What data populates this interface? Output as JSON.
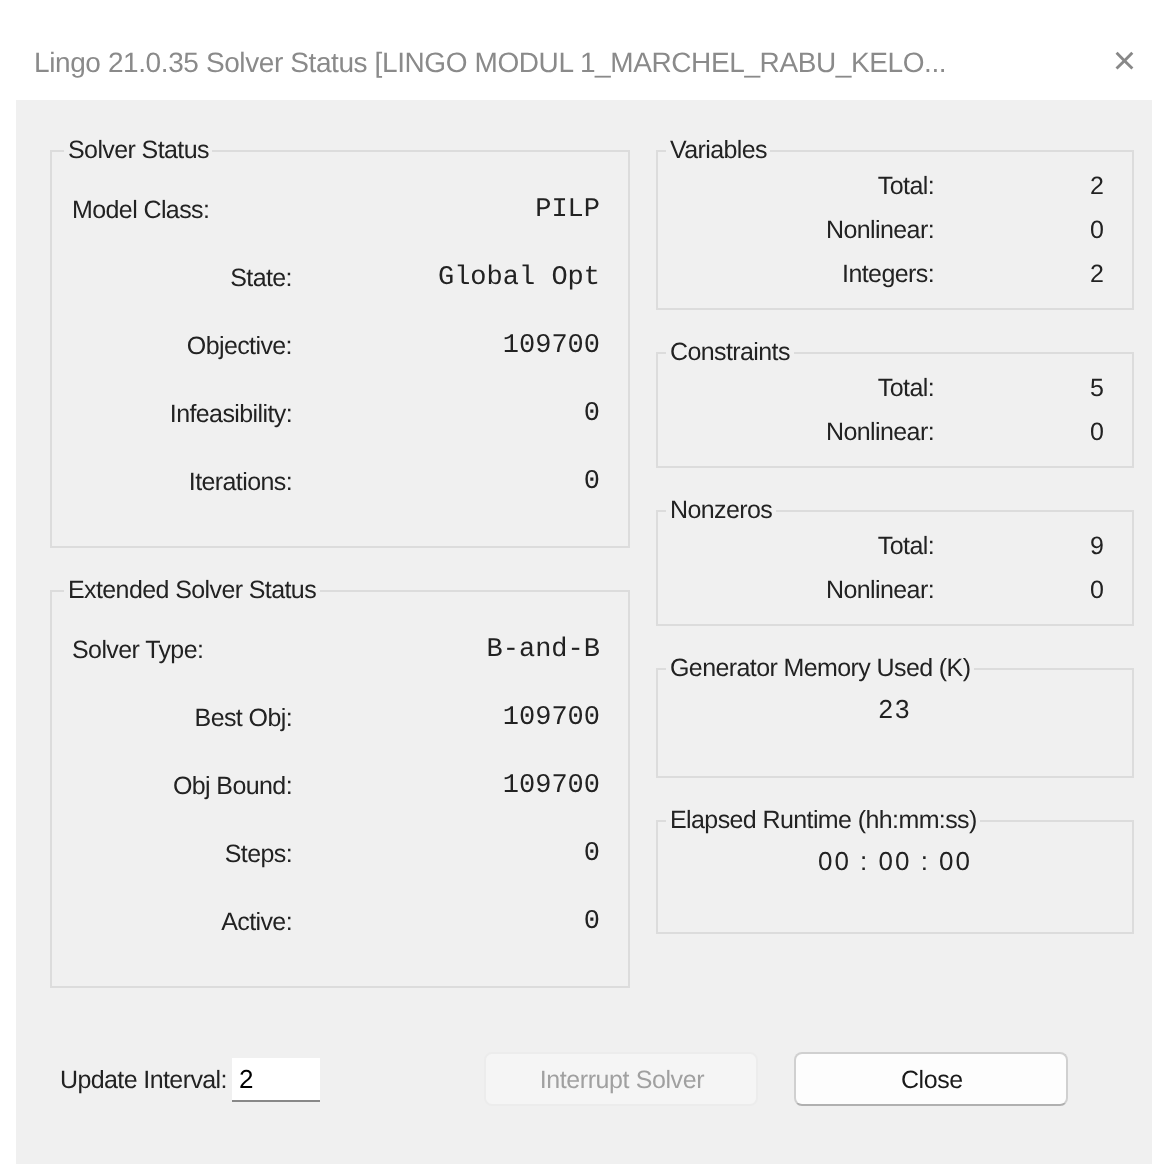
{
  "window": {
    "title": "Lingo 21.0.35 Solver Status [LINGO MODUL 1_MARCHEL_RABU_KELO...",
    "close": "×"
  },
  "solver_status": {
    "title": "Solver Status",
    "rows": [
      {
        "label": "Model Class:",
        "value": "PILP",
        "kind": "leading"
      },
      {
        "label": "State:",
        "value": "Global Opt",
        "kind": "plain"
      },
      {
        "label": "Objective:",
        "value": "109700",
        "kind": "plain"
      },
      {
        "label": "Infeasibility:",
        "value": "0",
        "kind": "plain"
      },
      {
        "label": "Iterations:",
        "value": "0",
        "kind": "plain"
      }
    ]
  },
  "extended_solver_status": {
    "title": "Extended Solver Status",
    "rows": [
      {
        "label": "Solver Type:",
        "value": "B-and-B",
        "kind": "leading"
      },
      {
        "label": "Best Obj:",
        "value": "109700",
        "kind": "plain"
      },
      {
        "label": "Obj Bound:",
        "value": "109700",
        "kind": "plain"
      },
      {
        "label": "Steps:",
        "value": "0",
        "kind": "plain"
      },
      {
        "label": "Active:",
        "value": "0",
        "kind": "plain"
      }
    ]
  },
  "counts": [
    {
      "title": "Variables",
      "rows": [
        {
          "label": "Total:",
          "value": "2"
        },
        {
          "label": "Nonlinear:",
          "value": "0"
        },
        {
          "label": "Integers:",
          "value": "2"
        }
      ]
    },
    {
      "title": "Constraints",
      "rows": [
        {
          "label": "Total:",
          "value": "5"
        },
        {
          "label": "Nonlinear:",
          "value": "0"
        }
      ]
    },
    {
      "title": "Nonzeros",
      "rows": [
        {
          "label": "Total:",
          "value": "9"
        },
        {
          "label": "Nonlinear:",
          "value": "0"
        }
      ]
    }
  ],
  "readouts": [
    {
      "title": "Generator Memory Used (K)",
      "value": "23"
    },
    {
      "title": "Elapsed Runtime (hh:mm:ss)",
      "value": "00 : 00 : 00"
    }
  ],
  "update_interval": {
    "label": "Update Interval:",
    "value": "2"
  },
  "buttons": [
    {
      "label": "Interrupt Solver",
      "disabled": true
    },
    {
      "label": "Close",
      "disabled": false
    }
  ]
}
